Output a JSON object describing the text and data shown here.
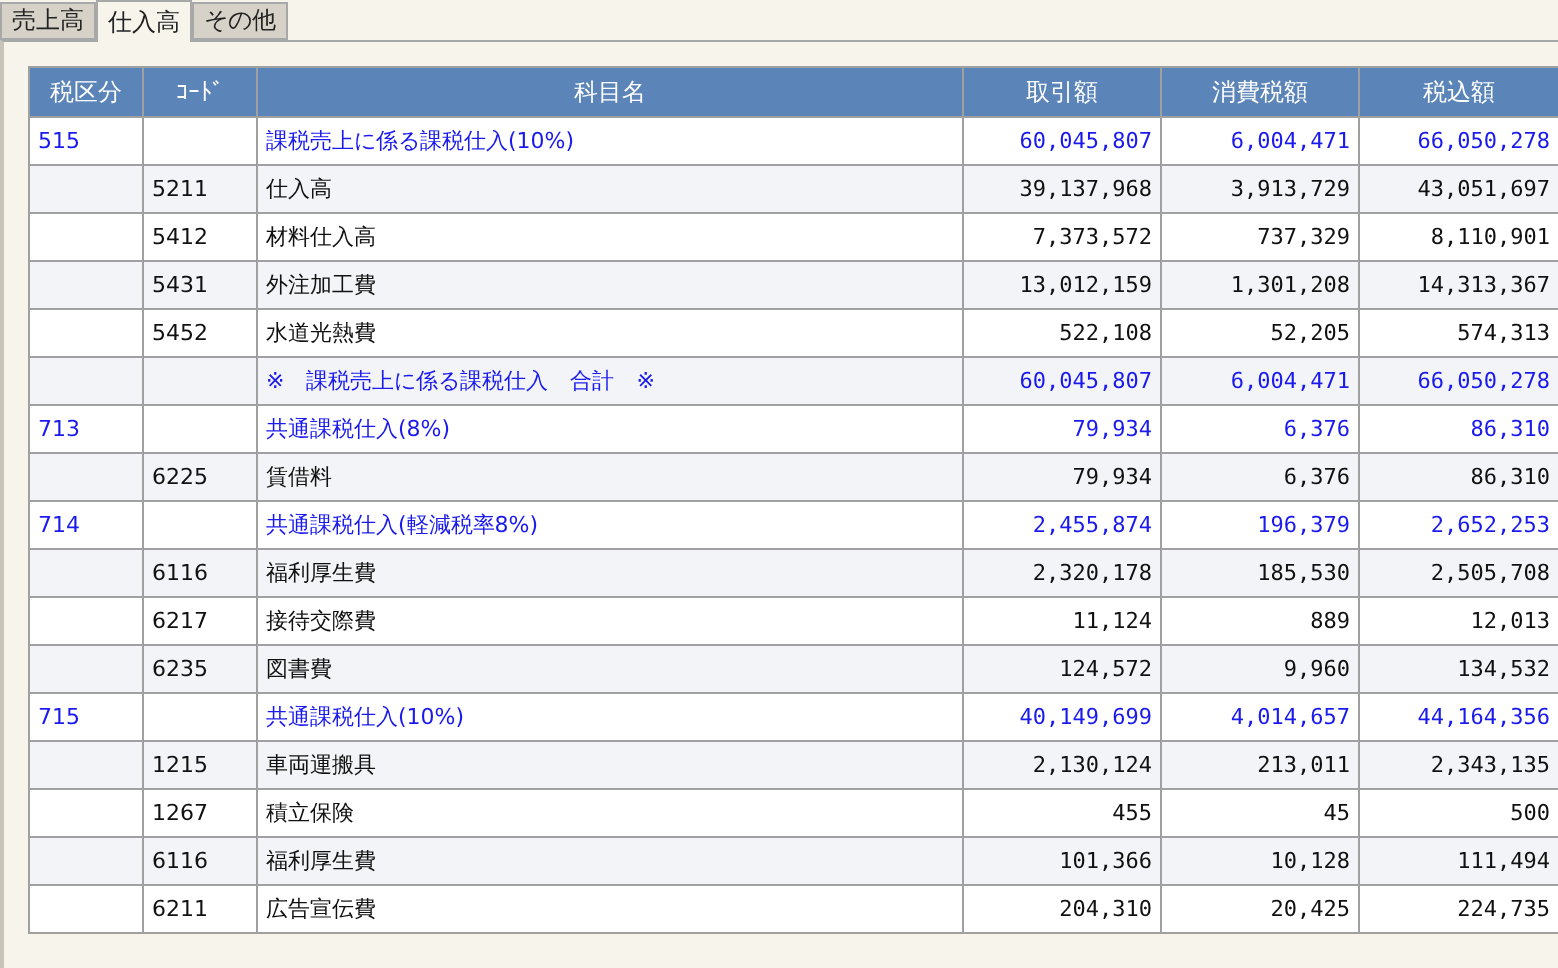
{
  "tabs": [
    {
      "label": "売上高",
      "selected": false
    },
    {
      "label": "仕入高",
      "selected": true
    },
    {
      "label": "その他",
      "selected": false
    }
  ],
  "table": {
    "columns": [
      "税区分",
      "ｺｰﾄﾞ",
      "科目名",
      "取引額",
      "消費税額",
      "税込額"
    ],
    "rows": [
      {
        "kind": "group",
        "tax_class": "515",
        "code": "",
        "name": "課税売上に係る課税仕入(10%)",
        "amount": "60,045,807",
        "tax": "6,004,471",
        "total": "66,050,278"
      },
      {
        "kind": "item",
        "tax_class": "",
        "code": "5211",
        "name": "仕入高",
        "amount": "39,137,968",
        "tax": "3,913,729",
        "total": "43,051,697"
      },
      {
        "kind": "item",
        "tax_class": "",
        "code": "5412",
        "name": "材料仕入高",
        "amount": "7,373,572",
        "tax": "737,329",
        "total": "8,110,901"
      },
      {
        "kind": "item",
        "tax_class": "",
        "code": "5431",
        "name": "外注加工費",
        "amount": "13,012,159",
        "tax": "1,301,208",
        "total": "14,313,367"
      },
      {
        "kind": "item",
        "tax_class": "",
        "code": "5452",
        "name": "水道光熱費",
        "amount": "522,108",
        "tax": "52,205",
        "total": "574,313"
      },
      {
        "kind": "total",
        "tax_class": "",
        "code": "",
        "name": "※　課税売上に係る課税仕入　合計　※",
        "amount": "60,045,807",
        "tax": "6,004,471",
        "total": "66,050,278"
      },
      {
        "kind": "group",
        "tax_class": "713",
        "code": "",
        "name": "共通課税仕入(8%)",
        "amount": "79,934",
        "tax": "6,376",
        "total": "86,310"
      },
      {
        "kind": "item",
        "tax_class": "",
        "code": "6225",
        "name": "賃借料",
        "amount": "79,934",
        "tax": "6,376",
        "total": "86,310"
      },
      {
        "kind": "group",
        "tax_class": "714",
        "code": "",
        "name": "共通課税仕入(軽減税率8%)",
        "amount": "2,455,874",
        "tax": "196,379",
        "total": "2,652,253"
      },
      {
        "kind": "item",
        "tax_class": "",
        "code": "6116",
        "name": "福利厚生費",
        "amount": "2,320,178",
        "tax": "185,530",
        "total": "2,505,708"
      },
      {
        "kind": "item",
        "tax_class": "",
        "code": "6217",
        "name": "接待交際費",
        "amount": "11,124",
        "tax": "889",
        "total": "12,013"
      },
      {
        "kind": "item",
        "tax_class": "",
        "code": "6235",
        "name": "図書費",
        "amount": "124,572",
        "tax": "9,960",
        "total": "134,532"
      },
      {
        "kind": "group",
        "tax_class": "715",
        "code": "",
        "name": "共通課税仕入(10%)",
        "amount": "40,149,699",
        "tax": "4,014,657",
        "total": "44,164,356"
      },
      {
        "kind": "item",
        "tax_class": "",
        "code": "1215",
        "name": "車両運搬具",
        "amount": "2,130,124",
        "tax": "213,011",
        "total": "2,343,135"
      },
      {
        "kind": "item",
        "tax_class": "",
        "code": "1267",
        "name": "積立保険",
        "amount": "455",
        "tax": "45",
        "total": "500"
      },
      {
        "kind": "item",
        "tax_class": "",
        "code": "6116",
        "name": "福利厚生費",
        "amount": "101,366",
        "tax": "10,128",
        "total": "111,494"
      },
      {
        "kind": "item",
        "tax_class": "",
        "code": "6211",
        "name": "広告宣伝費",
        "amount": "204,310",
        "tax": "20,425",
        "total": "224,735"
      }
    ]
  }
}
